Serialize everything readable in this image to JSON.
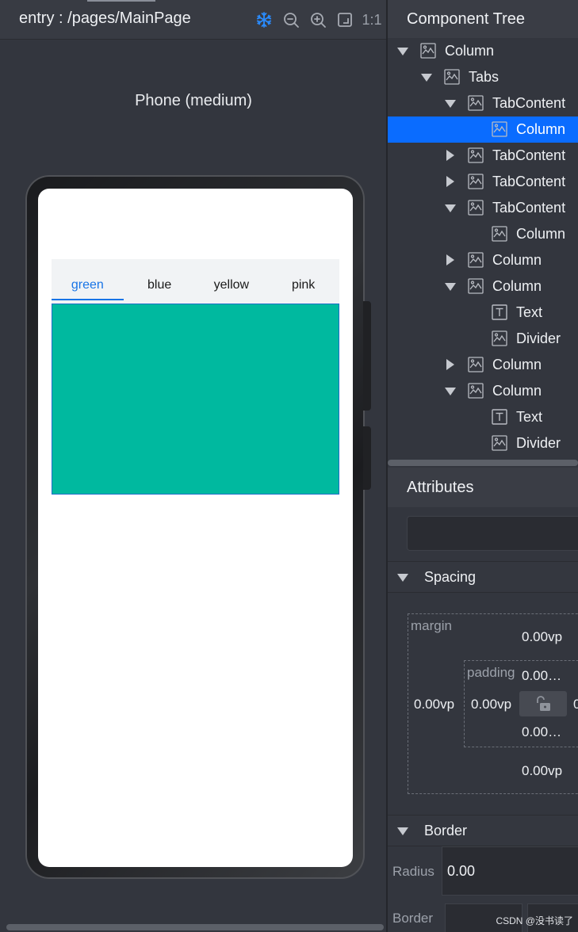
{
  "preview": {
    "page_path": "entry : /pages/MainPage",
    "toolbar_icons": [
      "freeze-icon",
      "zoom-out-icon",
      "zoom-in-icon",
      "fit-screen-icon"
    ],
    "ratio_label": "1:1",
    "device_label": "Phone (medium)",
    "tabs": [
      {
        "label": "green",
        "active": true
      },
      {
        "label": "blue",
        "active": false
      },
      {
        "label": "yellow",
        "active": false
      },
      {
        "label": "pink",
        "active": false
      }
    ],
    "tab_content_color": "#00b99f"
  },
  "tree": {
    "title": "Component Tree",
    "nodes": [
      {
        "label": "Column",
        "depth": 0,
        "state": "expanded",
        "icon": "component-icon"
      },
      {
        "label": "Tabs",
        "depth": 1,
        "state": "expanded",
        "icon": "component-icon"
      },
      {
        "label": "TabContent",
        "depth": 2,
        "state": "expanded",
        "icon": "component-icon"
      },
      {
        "label": "Column",
        "depth": 3,
        "state": "leaf",
        "icon": "component-icon",
        "selected": true
      },
      {
        "label": "TabContent",
        "depth": 2,
        "state": "collapsed",
        "icon": "component-icon"
      },
      {
        "label": "TabContent",
        "depth": 2,
        "state": "collapsed",
        "icon": "component-icon"
      },
      {
        "label": "TabContent",
        "depth": 2,
        "state": "expanded",
        "icon": "component-icon"
      },
      {
        "label": "Column",
        "depth": 3,
        "state": "leaf",
        "icon": "component-icon"
      },
      {
        "label": "Column",
        "depth": 2,
        "state": "collapsed",
        "icon": "component-icon"
      },
      {
        "label": "Column",
        "depth": 2,
        "state": "expanded",
        "icon": "component-icon"
      },
      {
        "label": "Text",
        "depth": 3,
        "state": "leaf",
        "icon": "text-icon"
      },
      {
        "label": "Divider",
        "depth": 3,
        "state": "leaf",
        "icon": "component-icon"
      },
      {
        "label": "Column",
        "depth": 2,
        "state": "collapsed",
        "icon": "component-icon"
      },
      {
        "label": "Column",
        "depth": 2,
        "state": "expanded",
        "icon": "component-icon"
      },
      {
        "label": "Text",
        "depth": 3,
        "state": "leaf",
        "icon": "text-icon"
      },
      {
        "label": "Divider",
        "depth": 3,
        "state": "leaf",
        "icon": "component-icon"
      }
    ]
  },
  "attributes": {
    "title": "Attributes",
    "spacing": {
      "section_label": "Spacing",
      "margin_label": "margin",
      "margin_top": "0.00vp",
      "margin_left": "0.00vp",
      "margin_bottom": "0.00vp",
      "padding_label": "padding",
      "padding_top": "0.00…",
      "padding_left": "0.00vp",
      "padding_bottom": "0.00…",
      "padding_right_partial": "0"
    },
    "border": {
      "section_label": "Border",
      "radius_label": "Radius",
      "radius_value": "0.00",
      "border_label": "Border"
    }
  },
  "watermark": "CSDN @没书读了"
}
